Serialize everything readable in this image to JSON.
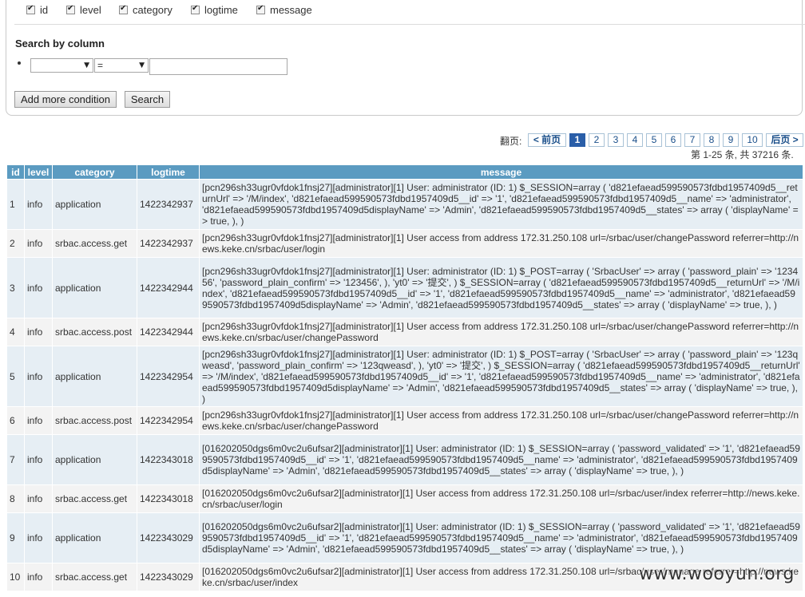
{
  "columns_toggle": [
    {
      "label": "id"
    },
    {
      "label": "level"
    },
    {
      "label": "category"
    },
    {
      "label": "logtime"
    },
    {
      "label": "message"
    }
  ],
  "search": {
    "title": "Search by column",
    "column_value": "",
    "operator_value": "=",
    "text_value": "",
    "add_condition_label": "Add more condition",
    "search_label": "Search"
  },
  "pager": {
    "label": "翻页:",
    "prev_label": "< 前页",
    "pages": [
      "1",
      "2",
      "3",
      "4",
      "5",
      "6",
      "7",
      "8",
      "9",
      "10"
    ],
    "current_page": "1",
    "next_label": "后页 >",
    "summary": "第 1-25 条, 共 37216 条."
  },
  "table": {
    "headers": [
      "id",
      "level",
      "category",
      "logtime",
      "message"
    ],
    "rows": [
      {
        "id": "1",
        "level": "info",
        "category": "application",
        "logtime": "1422342937",
        "message": "[pcn296sh33ugr0vfdok1fnsj27][administrator][1] User: administrator (ID: 1) $_SESSION=array ( 'd821efaead599590573fdbd1957409d5__returnUrl' => '/M/index', 'd821efaead599590573fdbd1957409d5__id' => '1', 'd821efaead599590573fdbd1957409d5__name' => 'administrator', 'd821efaead599590573fdbd1957409d5displayName' => 'Admin', 'd821efaead599590573fdbd1957409d5__states' => array ( 'displayName' => true, ), )"
      },
      {
        "id": "2",
        "level": "info",
        "category": "srbac.access.get",
        "logtime": "1422342937",
        "message": "[pcn296sh33ugr0vfdok1fnsj27][administrator][1] User access from address 172.31.250.108 url=/srbac/user/changePassword referrer=http://news.keke.cn/srbac/user/login"
      },
      {
        "id": "3",
        "level": "info",
        "category": "application",
        "logtime": "1422342944",
        "message": "[pcn296sh33ugr0vfdok1fnsj27][administrator][1] User: administrator (ID: 1) $_POST=array ( 'SrbacUser' => array ( 'password_plain' => '123456', 'password_plain_confirm' => '123456', ), 'yt0' => '提交', ) $_SESSION=array ( 'd821efaead599590573fdbd1957409d5__returnUrl' => '/M/index', 'd821efaead599590573fdbd1957409d5__id' => '1', 'd821efaead599590573fdbd1957409d5__name' => 'administrator', 'd821efaead599590573fdbd1957409d5displayName' => 'Admin', 'd821efaead599590573fdbd1957409d5__states' => array ( 'displayName' => true, ), )"
      },
      {
        "id": "4",
        "level": "info",
        "category": "srbac.access.post",
        "logtime": "1422342944",
        "message": "[pcn296sh33ugr0vfdok1fnsj27][administrator][1] User access from address 172.31.250.108 url=/srbac/user/changePassword referrer=http://news.keke.cn/srbac/user/changePassword"
      },
      {
        "id": "5",
        "level": "info",
        "category": "application",
        "logtime": "1422342954",
        "message": "[pcn296sh33ugr0vfdok1fnsj27][administrator][1] User: administrator (ID: 1) $_POST=array ( 'SrbacUser' => array ( 'password_plain' => '123qweasd', 'password_plain_confirm' => '123qweasd', ), 'yt0' => '提交', ) $_SESSION=array ( 'd821efaead599590573fdbd1957409d5__returnUrl' => '/M/index', 'd821efaead599590573fdbd1957409d5__id' => '1', 'd821efaead599590573fdbd1957409d5__name' => 'administrator', 'd821efaead599590573fdbd1957409d5displayName' => 'Admin', 'd821efaead599590573fdbd1957409d5__states' => array ( 'displayName' => true, ), )"
      },
      {
        "id": "6",
        "level": "info",
        "category": "srbac.access.post",
        "logtime": "1422342954",
        "message": "[pcn296sh33ugr0vfdok1fnsj27][administrator][1] User access from address 172.31.250.108 url=/srbac/user/changePassword referrer=http://news.keke.cn/srbac/user/changePassword"
      },
      {
        "id": "7",
        "level": "info",
        "category": "application",
        "logtime": "1422343018",
        "message": "[016202050dgs6m0vc2u6ufsar2][administrator][1] User: administrator (ID: 1) $_SESSION=array ( 'password_validated' => '1', 'd821efaead599590573fdbd1957409d5__id' => '1', 'd821efaead599590573fdbd1957409d5__name' => 'administrator', 'd821efaead599590573fdbd1957409d5displayName' => 'Admin', 'd821efaead599590573fdbd1957409d5__states' => array ( 'displayName' => true, ), )"
      },
      {
        "id": "8",
        "level": "info",
        "category": "srbac.access.get",
        "logtime": "1422343018",
        "message": "[016202050dgs6m0vc2u6ufsar2][administrator][1] User access from address 172.31.250.108 url=/srbac/user/index referrer=http://news.keke.cn/srbac/user/login"
      },
      {
        "id": "9",
        "level": "info",
        "category": "application",
        "logtime": "1422343029",
        "message": "[016202050dgs6m0vc2u6ufsar2][administrator][1] User: administrator (ID: 1) $_SESSION=array ( 'password_validated' => '1', 'd821efaead599590573fdbd1957409d5__id' => '1', 'd821efaead599590573fdbd1957409d5__name' => 'administrator', 'd821efaead599590573fdbd1957409d5displayName' => 'Admin', 'd821efaead599590573fdbd1957409d5__states' => array ( 'displayName' => true, ), )"
      },
      {
        "id": "10",
        "level": "info",
        "category": "srbac.access.get",
        "logtime": "1422343029",
        "message": "[016202050dgs6m0vc2u6ufsar2][administrator][1] User access from address 172.31.250.108 url=/srbac/user/manage referrer=http://news.keke.cn/srbac/user/index"
      }
    ]
  },
  "watermark": "www.wooyun.org"
}
